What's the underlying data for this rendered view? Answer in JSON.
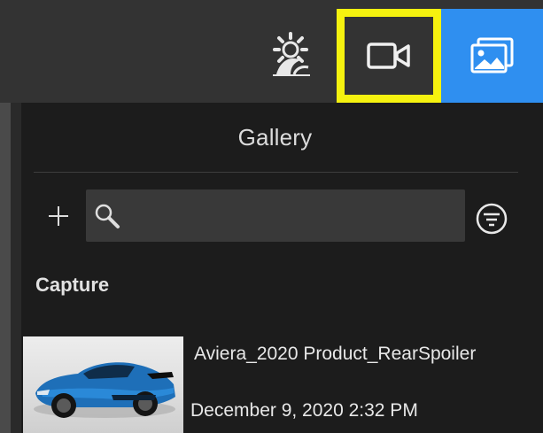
{
  "toolbar": {
    "buttons": [
      {
        "icon": "environment-icon",
        "active": false
      },
      {
        "icon": "video-camera-icon",
        "active": false,
        "highlighted": true
      },
      {
        "icon": "image-gallery-icon",
        "active": true
      }
    ],
    "highlight_color": "#f5f20f",
    "active_color": "#2f8ff0"
  },
  "panel": {
    "title": "Gallery",
    "add_label": "+",
    "search": {
      "value": "",
      "placeholder": ""
    },
    "section_title": "Capture",
    "items": [
      {
        "name": "Aviera_2020 Product_RearSpoiler",
        "date": "December 9, 2020 2:32 PM",
        "thumbnail": "blue-sports-car"
      }
    ]
  }
}
